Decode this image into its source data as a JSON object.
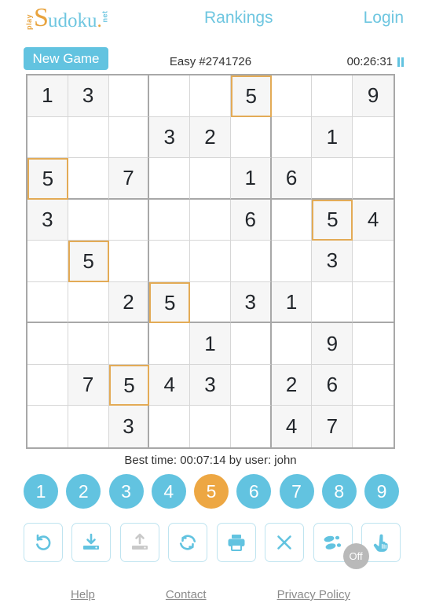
{
  "header": {
    "logo": {
      "play": "play",
      "s": "S",
      "udoku": "udoku",
      "dot": ".",
      "net": "net"
    },
    "rankings_label": "Rankings",
    "login_label": "Login"
  },
  "subbar": {
    "new_game_label": "New Game",
    "puzzle_label": "Easy #2741726",
    "timer": "00:26:31",
    "pause_icon": "pause-icon"
  },
  "grid": {
    "rows": [
      [
        "1",
        "3",
        "",
        "",
        "",
        "5",
        "",
        "",
        "9"
      ],
      [
        "",
        "",
        "",
        "3",
        "2",
        "",
        "",
        "1",
        ""
      ],
      [
        "5",
        "",
        "7",
        "",
        "",
        "1",
        "6",
        "",
        ""
      ],
      [
        "3",
        "",
        "",
        "",
        "",
        "6",
        "",
        "5",
        "4"
      ],
      [
        "",
        "5",
        "",
        "",
        "",
        "",
        "",
        "3",
        ""
      ],
      [
        "",
        "",
        "2",
        "5",
        "",
        "3",
        "1",
        "",
        ""
      ],
      [
        "",
        "",
        "",
        "",
        "1",
        "",
        "",
        "9",
        ""
      ],
      [
        "",
        "7",
        "5",
        "4",
        "3",
        "",
        "2",
        "6",
        ""
      ],
      [
        "",
        "",
        "3",
        "",
        "",
        "",
        "4",
        "7",
        ""
      ]
    ],
    "highlighted": [
      [
        0,
        5
      ],
      [
        2,
        0
      ],
      [
        3,
        7
      ],
      [
        4,
        1
      ],
      [
        5,
        3
      ],
      [
        7,
        2
      ]
    ]
  },
  "best_time": "Best time: 00:07:14 by user: john",
  "numpad": {
    "buttons": [
      "1",
      "2",
      "3",
      "4",
      "5",
      "6",
      "7",
      "8",
      "9"
    ],
    "selected": "5"
  },
  "toolbar": {
    "buttons": [
      {
        "name": "undo-button",
        "icon": "undo-icon",
        "disabled": false
      },
      {
        "name": "save-button",
        "icon": "download-icon",
        "disabled": false
      },
      {
        "name": "load-button",
        "icon": "upload-icon",
        "disabled": true
      },
      {
        "name": "restart-button",
        "icon": "refresh-icon",
        "disabled": false
      },
      {
        "name": "print-button",
        "icon": "printer-icon",
        "disabled": false
      },
      {
        "name": "erase-button",
        "icon": "x-icon",
        "disabled": false
      },
      {
        "name": "steps-button",
        "icon": "footsteps-icon",
        "disabled": false,
        "badge": "Off"
      },
      {
        "name": "hint-button",
        "icon": "pointing-hand-icon",
        "disabled": false
      }
    ]
  },
  "footer": {
    "links": [
      "Help",
      "Contact",
      "Privacy Policy"
    ]
  },
  "colors": {
    "accent_blue": "#62c3e0",
    "accent_orange": "#eda743",
    "highlight_border": "#e3ab56",
    "cell_filled": "#f6f6f6",
    "grid_line": "#d6d6d6",
    "grid_line_bold": "#a8a8a8"
  }
}
